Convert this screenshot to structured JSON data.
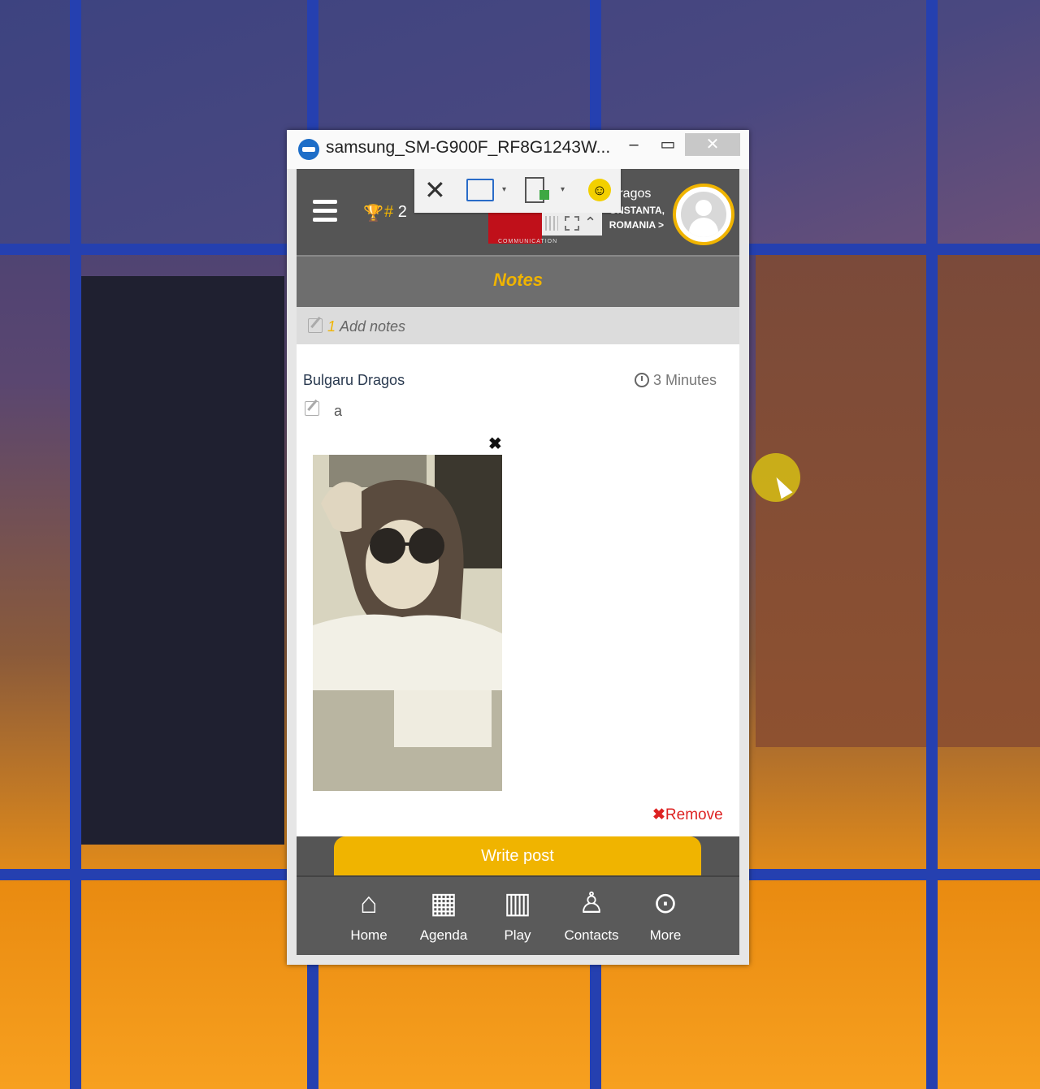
{
  "window": {
    "title": "samsung_SM-G900F_RF8G1243W...",
    "minimize": "–",
    "maximize": "▭",
    "close": "✕"
  },
  "header": {
    "rank_hash": "#",
    "rank_value": "2",
    "logo_subtitle": "COMMUNICATION",
    "user_name": "Dragos",
    "user_city": "ONSTANTA,",
    "user_country": "ROMANIA >"
  },
  "toolbar": {
    "close_glyph": "✕",
    "caret": "▾",
    "up": "⌃"
  },
  "section": {
    "title": "Notes"
  },
  "add_notes": {
    "count": "1",
    "label": "Add notes"
  },
  "post": {
    "author": "Bulgaru Dragos",
    "time": "3 Minutes",
    "text": "a",
    "image_close": "✖",
    "remove_x": "✖",
    "remove_label": "Remove"
  },
  "write_post": {
    "label": "Write post"
  },
  "bottom_nav": [
    {
      "label": "Home",
      "icon": "home-icon"
    },
    {
      "label": "Agenda",
      "icon": "calendar-icon"
    },
    {
      "label": "Play",
      "icon": "building-icon"
    },
    {
      "label": "Contacts",
      "icon": "add-contact-icon"
    },
    {
      "label": "More",
      "icon": "more-icon"
    }
  ],
  "colors": {
    "accent": "#f0b400",
    "header": "#555555",
    "remove": "#dd2222"
  }
}
